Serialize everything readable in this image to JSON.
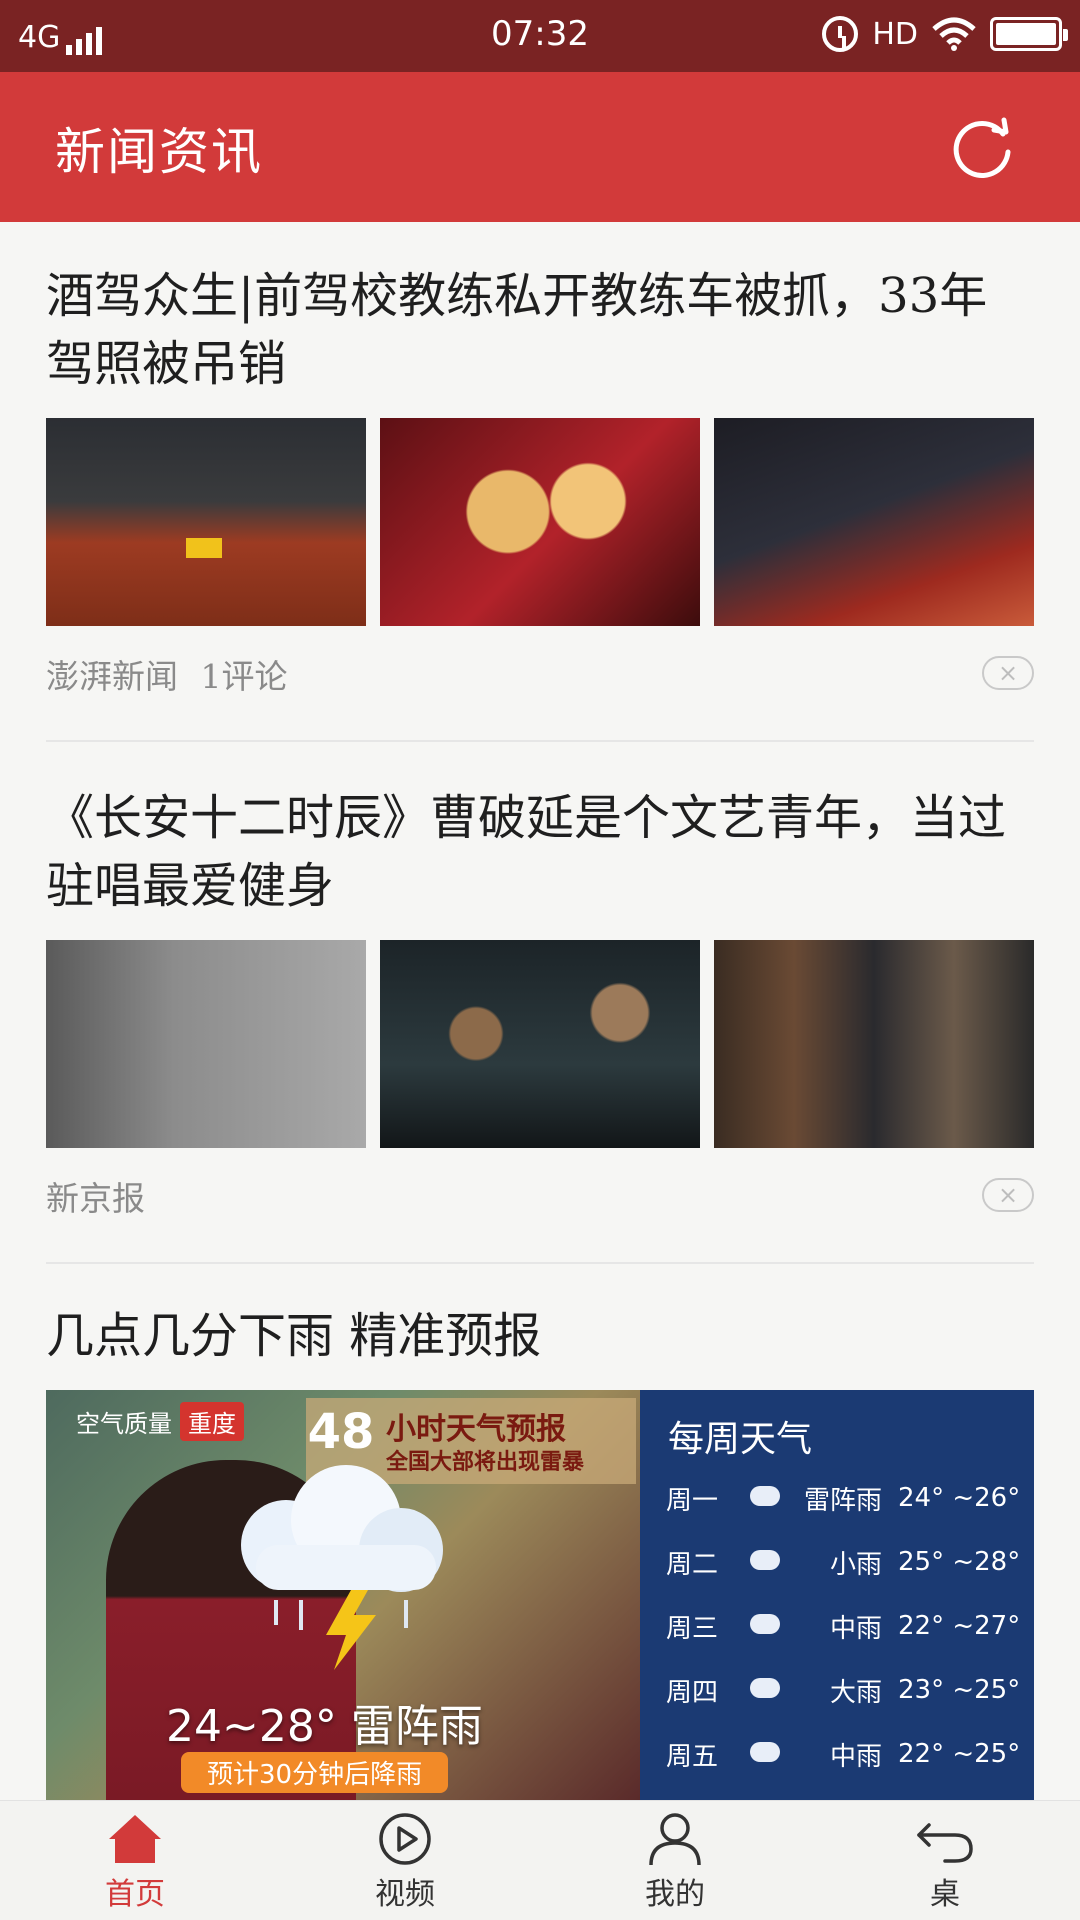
{
  "status_bar": {
    "network": "4G",
    "time": "07:32",
    "hd": "HD"
  },
  "header": {
    "title": "新闻资讯",
    "refresh_icon": "refresh-icon"
  },
  "articles": [
    {
      "title": "酒驾众生|前驾校教练私开教练车被抓，33年驾照被吊销",
      "source": "澎湃新闻",
      "comments": "1评论",
      "dismiss": "×"
    },
    {
      "title": "《长安十二时辰》曹破延是个文艺青年，当过驻唱最爱健身",
      "source": "新京报",
      "dismiss": "×"
    },
    {
      "title": "几点几分下雨  精准预报"
    }
  ],
  "weather_banner": {
    "air_quality_label": "空气质量",
    "air_quality_level": "重度",
    "hours": "48",
    "forecast_title": "小时天气预报",
    "forecast_sub": "全国大部将出现雷暴",
    "temp": "24~28° 雷阵雨",
    "rain_note": "预计30分钟后降雨",
    "week_title": "每周天气",
    "week": [
      {
        "day": "周一",
        "cond": "雷阵雨",
        "range": "24° ~26°"
      },
      {
        "day": "周二",
        "cond": "小雨",
        "range": "25° ~28°"
      },
      {
        "day": "周三",
        "cond": "中雨",
        "range": "22° ~27°"
      },
      {
        "day": "周四",
        "cond": "大雨",
        "range": "23° ~25°"
      },
      {
        "day": "周五",
        "cond": "中雨",
        "range": "22° ~25°"
      }
    ]
  },
  "bottom_nav": [
    {
      "label": "首页",
      "icon": "home-icon",
      "active": true
    },
    {
      "label": "视频",
      "icon": "play-icon",
      "active": false
    },
    {
      "label": "我的",
      "icon": "user-icon",
      "active": false
    },
    {
      "label": "桌",
      "icon": "back-icon",
      "active": false
    }
  ],
  "colors": {
    "status_bar": "#7a2323",
    "header": "#d23a3a",
    "accent": "#d23a3a",
    "week_panel": "#1b3a73"
  }
}
